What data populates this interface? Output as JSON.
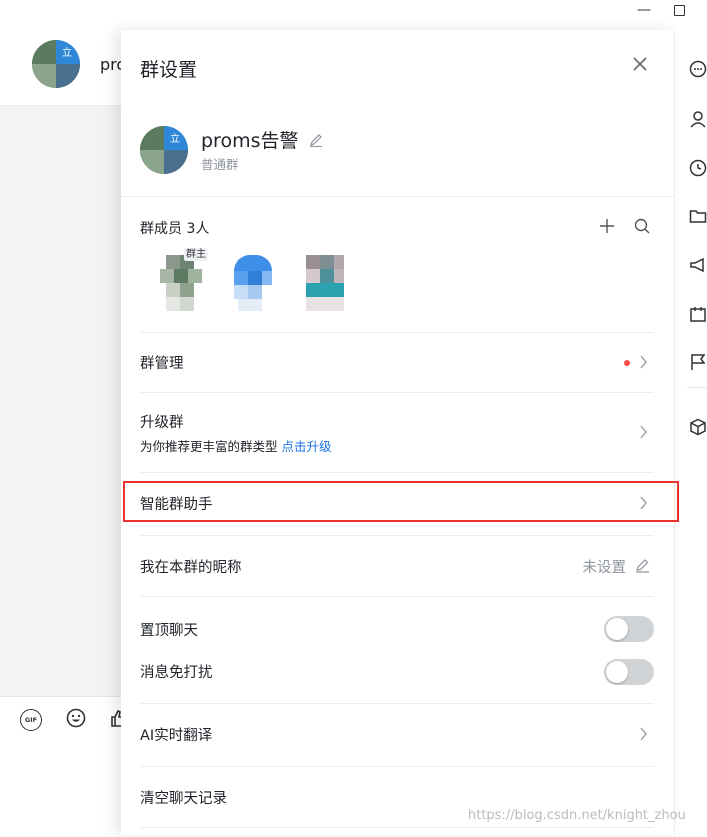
{
  "chat": {
    "title_partial": "pro"
  },
  "toolbar": {
    "gif_label": "GIF"
  },
  "panel": {
    "title": "群设置",
    "group_name": "proms告警",
    "group_type": "普通群",
    "avatar_badge": "立"
  },
  "members": {
    "label": "群成员 3人",
    "owner_badge": "群主",
    "items": [
      {
        "role": "群主"
      },
      {
        "role": ""
      },
      {
        "role": ""
      }
    ]
  },
  "rows": {
    "group_manage": "群管理",
    "upgrade_title": "升级群",
    "upgrade_desc": "为你推荐更丰富的群类型",
    "upgrade_link": "点击升级",
    "smart_assistant": "智能群助手",
    "nickname_label": "我在本群的昵称",
    "nickname_value": "未设置",
    "pin_chat": "置顶聊天",
    "mute": "消息免打扰",
    "ai_translate": "AI实时翻译",
    "clear_history": "清空聊天记录"
  },
  "toggles": {
    "pin_chat_on": false,
    "mute_on": false
  },
  "colors": {
    "link": "#1a73e8",
    "highlight": "#e8322c",
    "notify_dot": "#f54a45",
    "toggle_off": "#d0d3d6"
  },
  "watermark": "https://blog.csdn.net/knight_zhou"
}
